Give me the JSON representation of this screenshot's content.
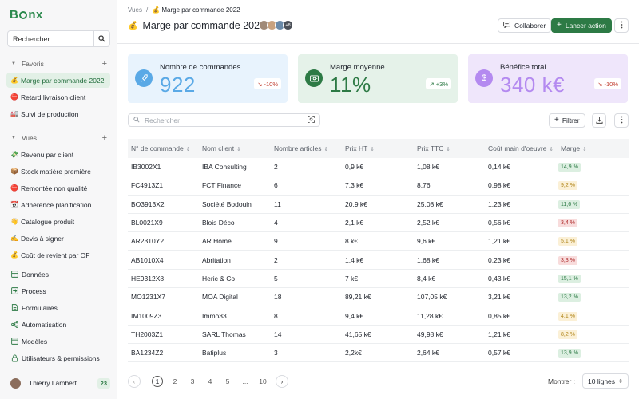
{
  "app": {
    "logo": "Bonx"
  },
  "sidebar": {
    "search_placeholder": "Rechercher",
    "favoris_label": "Favoris",
    "favoris": [
      {
        "emoji": "💰",
        "label": "Marge par commande 2022",
        "active": true
      },
      {
        "emoji": "⛔",
        "label": "Retard livraison client"
      },
      {
        "emoji": "🏭",
        "label": "Suivi de production"
      }
    ],
    "vues_label": "Vues",
    "vues": [
      {
        "emoji": "💸",
        "label": "Revenu par client"
      },
      {
        "emoji": "📦",
        "label": "Stock matière première"
      },
      {
        "emoji": "⛔",
        "label": "Remontée non qualité"
      },
      {
        "emoji": "📆",
        "label": "Adhérence planification"
      },
      {
        "emoji": "👋",
        "label": "Catalogue produit"
      },
      {
        "emoji": "✍️",
        "label": "Devis à signer"
      },
      {
        "emoji": "💰",
        "label": "Coût de revient par OF"
      }
    ],
    "modules": [
      {
        "icon": "table-icon",
        "label": "Données"
      },
      {
        "icon": "process-icon",
        "label": "Process"
      },
      {
        "icon": "form-icon",
        "label": "Formulaires"
      },
      {
        "icon": "automation-icon",
        "label": "Automatisation"
      },
      {
        "icon": "template-icon",
        "label": "Modèles"
      },
      {
        "icon": "lock-icon",
        "label": "Utilisateurs & permissions"
      }
    ],
    "user": {
      "name": "Thierry Lambert",
      "badge": "23"
    }
  },
  "header": {
    "breadcrumb_root": "Vues",
    "breadcrumb_sep": "/",
    "breadcrumb_current": "💰 Marge par commande 2022",
    "title_emoji": "💰",
    "title": "Marge par commande 2022",
    "avatars_more": "+8",
    "collaborate": "Collaborer",
    "launch": "Lancer action"
  },
  "kpis": [
    {
      "label": "Nombre de commandes",
      "value": "922",
      "trend": "-10%",
      "direction": "down",
      "bg": "#e8f3fd",
      "color": "#5aa9e6",
      "icon": "rocket-icon"
    },
    {
      "label": "Marge moyenne",
      "value": "11%",
      "trend": "+3%",
      "direction": "up",
      "bg": "#e5f2e9",
      "color": "#2d7a45",
      "icon": "money-icon"
    },
    {
      "label": "Bénéfice total",
      "value": "340 k€",
      "trend": "-10%",
      "direction": "down",
      "bg": "#efe6fb",
      "color": "#b48af0",
      "icon": "dollar-icon"
    }
  ],
  "toolbar": {
    "search_placeholder": "Rechercher",
    "filter": "Filtrer"
  },
  "table": {
    "columns": [
      "N° de commande",
      "Nom client",
      "Nombre articles",
      "Prix HT",
      "Prix TTC",
      "Coût main d'oeuvre",
      "Marge"
    ],
    "rows": [
      [
        "IB3002X1",
        "IBA Consulting",
        "2",
        "0,9 k€",
        "1,08 k€",
        "0,14 k€",
        "14,9 %",
        "g"
      ],
      [
        "FC4913Z1",
        "FCT Finance",
        "6",
        "7,3 k€",
        "8,76",
        "0,98 k€",
        "9,2 %",
        "y"
      ],
      [
        "BO3913X2",
        "Société Bodouin",
        "11",
        "20,9 k€",
        "25,08 k€",
        "1,23 k€",
        "11,6 %",
        "g"
      ],
      [
        "BL0021X9",
        "Blois Déco",
        "4",
        "2,1 k€",
        "2,52 k€",
        "0,56 k€",
        "3,4 %",
        "r"
      ],
      [
        "AR2310Y2",
        "AR Home",
        "9",
        "8 k€",
        "9,6 k€",
        "1,21 k€",
        "5,1 %",
        "y"
      ],
      [
        "AB1010X4",
        "Abritation",
        "2",
        "1,4 k€",
        "1,68 k€",
        "0,23 k€",
        "3,3 %",
        "r"
      ],
      [
        "HE9312X8",
        "Heric & Co",
        "5",
        "7 k€",
        "8,4 k€",
        "0,43 k€",
        "15,1 %",
        "g"
      ],
      [
        "MO1231X7",
        "MOA Digital",
        "18",
        "89,21 k€",
        "107,05 k€",
        "3,21 k€",
        "13,2 %",
        "g"
      ],
      [
        "IM1009Z3",
        "Immo33",
        "8",
        "9,4 k€",
        "11,28 k€",
        "0,85 k€",
        "4,1 %",
        "y"
      ],
      [
        "TH2003Z1",
        "SARL Thomas",
        "14",
        "41,65 k€",
        "49,98 k€",
        "1,21 k€",
        "8,2 %",
        "y"
      ],
      [
        "BA1234Z2",
        "Batiplus",
        "3",
        "2,2k€",
        "2,64 k€",
        "0,57 k€",
        "13,9 %",
        "g"
      ]
    ]
  },
  "pagination": {
    "pages": [
      "1",
      "2",
      "3",
      "4",
      "5",
      "...",
      "10"
    ],
    "current": "1",
    "show_label": "Montrer :",
    "per_page": "10 lignes"
  }
}
